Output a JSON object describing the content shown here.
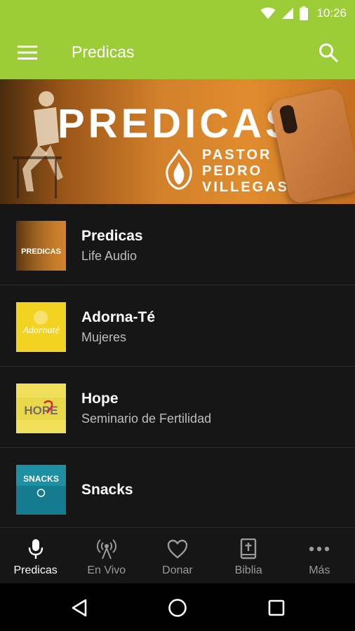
{
  "status_bar": {
    "time": "10:26"
  },
  "app_bar": {
    "title": "Predicas"
  },
  "banner": {
    "title": "PREDICAS",
    "subtitle_lines": [
      "PASTOR",
      "PEDRO",
      "VILLEGAS"
    ]
  },
  "list": [
    {
      "title": "Predicas",
      "subtitle": "Life Audio",
      "thumb_text": "PREDICAS"
    },
    {
      "title": "Adorna-Té",
      "subtitle": "Mujeres",
      "thumb_text": "Adornaté"
    },
    {
      "title": "Hope",
      "subtitle": "Seminario de Fertilidad",
      "thumb_text": "HOPE"
    },
    {
      "title": "Snacks",
      "subtitle": "",
      "thumb_text": "SNACKS"
    }
  ],
  "bottom_nav": [
    {
      "label": "Predicas",
      "icon": "microphone-icon",
      "active": true
    },
    {
      "label": "En Vivo",
      "icon": "broadcast-icon",
      "active": false
    },
    {
      "label": "Donar",
      "icon": "heart-icon",
      "active": false
    },
    {
      "label": "Biblia",
      "icon": "bible-icon",
      "active": false
    },
    {
      "label": "Más",
      "icon": "more-icon",
      "active": false
    }
  ],
  "colors": {
    "accent": "#9ccd36",
    "background": "#161616",
    "subtitle": "#bdbdbd",
    "nav_inactive": "#9a9a9a"
  }
}
